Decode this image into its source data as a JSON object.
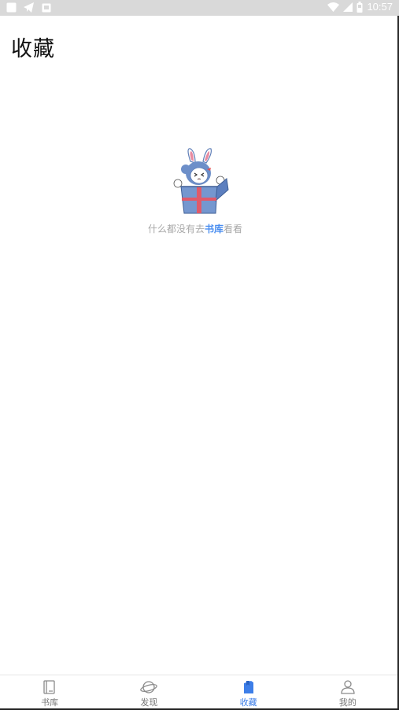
{
  "status_bar": {
    "time": "10:57"
  },
  "page": {
    "title": "收藏"
  },
  "empty_state": {
    "text_before": "什么都没有去",
    "link_text": "书库",
    "text_after": "看看"
  },
  "bottom_nav": {
    "items": [
      {
        "label": "书库",
        "icon": "book-icon",
        "active": false
      },
      {
        "label": "发现",
        "icon": "planet-icon",
        "active": false
      },
      {
        "label": "收藏",
        "icon": "bookmark-icon",
        "active": true
      },
      {
        "label": "我的",
        "icon": "user-icon",
        "active": false
      }
    ]
  },
  "colors": {
    "accent": "#3d7ee8",
    "link": "#4a8ef0",
    "inactive": "#777777",
    "hint_text": "#a8a8a8",
    "status_bar_bg": "#d9d9d9"
  }
}
